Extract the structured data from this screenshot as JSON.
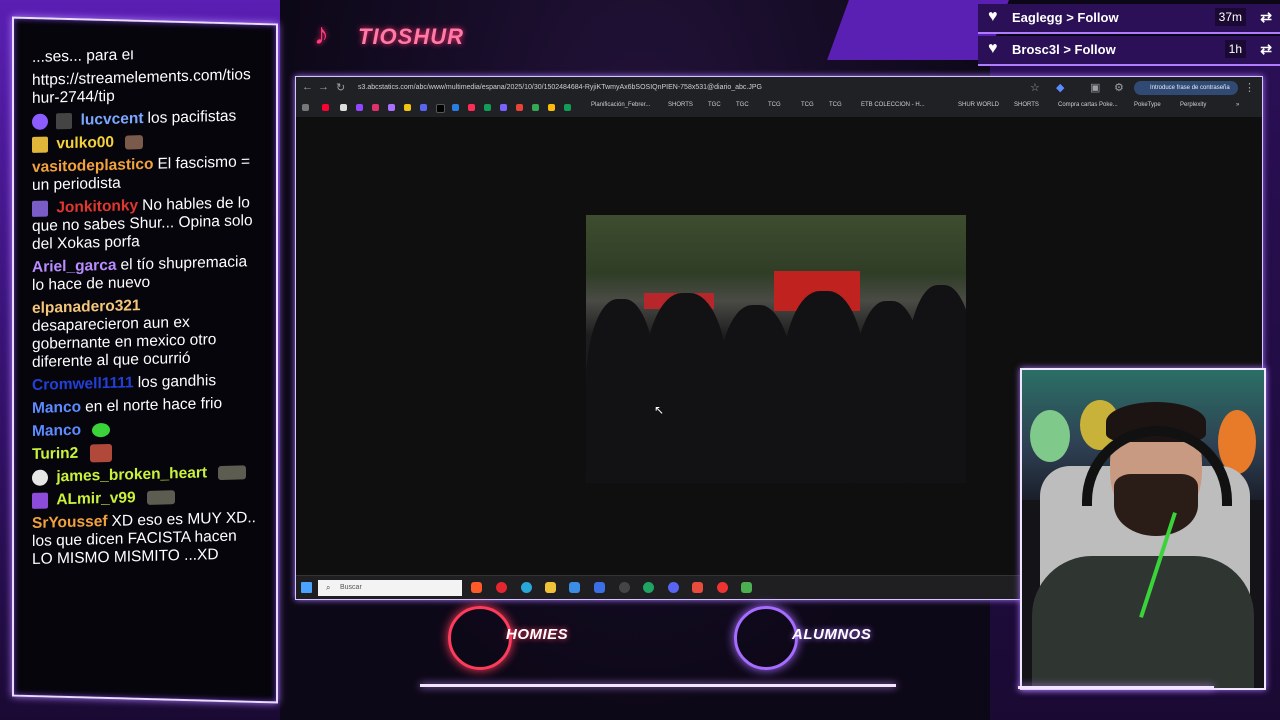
{
  "channel": {
    "name": "TIOSHUR",
    "logo_icon": "tiktok-icon"
  },
  "follows": [
    {
      "user": "Eaglegg",
      "action": "Follow",
      "time": "37m"
    },
    {
      "user": "Brosc3l",
      "action": "Follow",
      "time": "1h"
    }
  ],
  "chat": {
    "messages": [
      {
        "user": "",
        "text": "...ses... para el",
        "color": "#ffffff"
      },
      {
        "user": "",
        "text": "https://streamelements.com/tioshur-2744/tip",
        "color": "#ffffff"
      },
      {
        "user": "lucvcent",
        "text": "los pacifistas",
        "color": "#7aa7ff"
      },
      {
        "user": "vulko00",
        "text": "",
        "color": "#f3d23a"
      },
      {
        "user": "vasitodeplastico",
        "text": "El fascismo = un periodista",
        "color": "#f2a23a"
      },
      {
        "user": "Jonkitonky",
        "text": "No hables de lo que no sabes Shur... Opina solo del Xokas porfa",
        "color": "#e0372f"
      },
      {
        "user": "Ariel_garca",
        "text": "el tío shupremacia lo hace de nuevo",
        "color": "#b98cff"
      },
      {
        "user": "elpanadero321",
        "text": "desaparecieron aun ex gobernante en mexico otro diferente al que ocurrió",
        "color": "#f3c67a"
      },
      {
        "user": "Cromwell1111",
        "text": "los gandhis",
        "color": "#2340d6"
      },
      {
        "user": "Manco",
        "text": "en el norte hace frio",
        "color": "#5c8cff"
      },
      {
        "user": "Manco",
        "text": "",
        "color": "#5c8cff"
      },
      {
        "user": "Turin2",
        "text": "",
        "color": "#c9f23a"
      },
      {
        "user": "james_broken_heart",
        "text": "",
        "color": "#c9f23a"
      },
      {
        "user": "ALmir_v99",
        "text": "",
        "color": "#c9f23a"
      },
      {
        "user": "SrYoussef",
        "text": "XD eso es MUY XD.. los que dicen FACISTA hacen LO MISMO MISMITO ...XD",
        "color": "#f2a23a"
      }
    ]
  },
  "browser": {
    "url": "s3.abcstatics.com/abc/www/multimedia/espana/2025/10/30/1502484684-RyjiKTwmyAx6bSOSIQnPIEN-758x531@diario_abc.JPG",
    "password_chip": "Introduce frase de contraseña",
    "bookmarks": [
      "Planificación_Febrer...",
      "SHORTS",
      "TGC",
      "TGC",
      "TCG",
      "TCG",
      "TCG",
      "ETB COLECCION - H...",
      "SHUR WORLD",
      "SHORTS",
      "Compra cartas Poke...",
      "PokeType",
      "Perplexity"
    ],
    "taskbar_search": "Buscar"
  },
  "badges": [
    {
      "label": "HOMIES",
      "color": "#ff3b5c"
    },
    {
      "label": "ALUMNOS",
      "color": "#a66bff"
    }
  ]
}
